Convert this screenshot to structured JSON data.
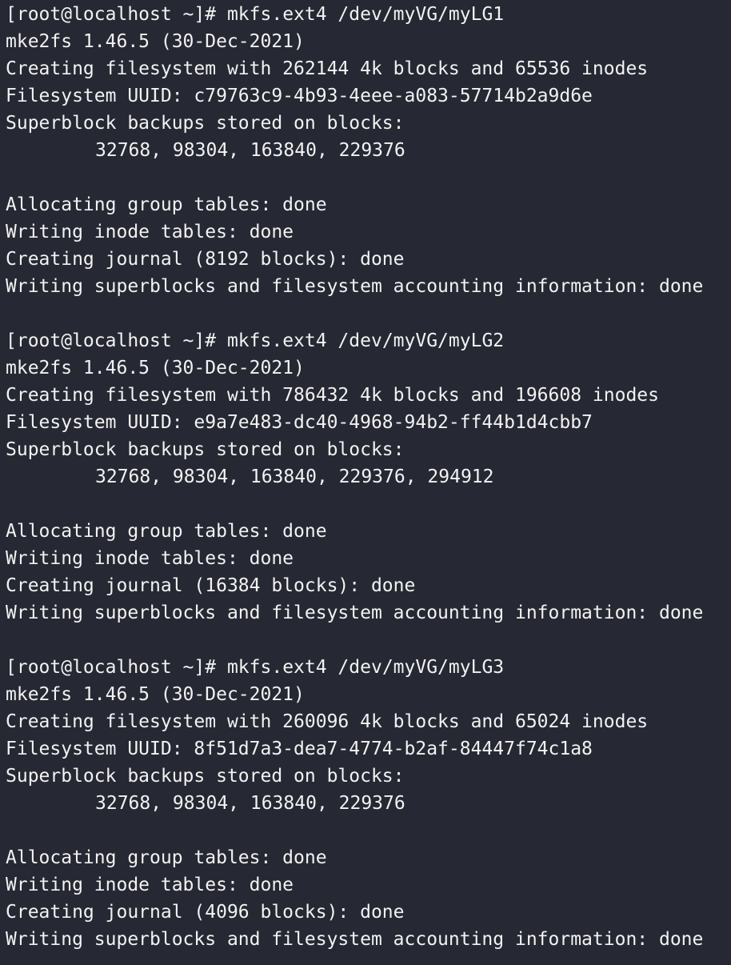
{
  "terminal": {
    "blocks": [
      {
        "prompt": "[root@localhost ~]# ",
        "command": "mkfs.ext4 /dev/myVG/myLG1",
        "version": "mke2fs 1.46.5 (30-Dec-2021)",
        "creating": "Creating filesystem with 262144 4k blocks and 65536 inodes",
        "uuid": "Filesystem UUID: c79763c9-4b93-4eee-a083-57714b2a9d6e",
        "superblock": "Superblock backups stored on blocks:",
        "blocks_list": "32768, 98304, 163840, 229376",
        "alloc": "Allocating group tables: done",
        "inode": "Writing inode tables: done",
        "journal": "Creating journal (8192 blocks): done",
        "superwrite": "Writing superblocks and filesystem accounting information: done"
      },
      {
        "prompt": "[root@localhost ~]# ",
        "command": "mkfs.ext4 /dev/myVG/myLG2",
        "version": "mke2fs 1.46.5 (30-Dec-2021)",
        "creating": "Creating filesystem with 786432 4k blocks and 196608 inodes",
        "uuid": "Filesystem UUID: e9a7e483-dc40-4968-94b2-ff44b1d4cbb7",
        "superblock": "Superblock backups stored on blocks:",
        "blocks_list": "32768, 98304, 163840, 229376, 294912",
        "alloc": "Allocating group tables: done",
        "inode": "Writing inode tables: done",
        "journal": "Creating journal (16384 blocks): done",
        "superwrite": "Writing superblocks and filesystem accounting information: done"
      },
      {
        "prompt": "[root@localhost ~]# ",
        "command": "mkfs.ext4 /dev/myVG/myLG3",
        "version": "mke2fs 1.46.5 (30-Dec-2021)",
        "creating": "Creating filesystem with 260096 4k blocks and 65024 inodes",
        "uuid": "Filesystem UUID: 8f51d7a3-dea7-4774-b2af-84447f74c1a8",
        "superblock": "Superblock backups stored on blocks:",
        "blocks_list": "32768, 98304, 163840, 229376",
        "alloc": "Allocating group tables: done",
        "inode": "Writing inode tables: done",
        "journal": "Creating journal (4096 blocks): done",
        "superwrite": "Writing superblocks and filesystem accounting information: done"
      }
    ]
  }
}
